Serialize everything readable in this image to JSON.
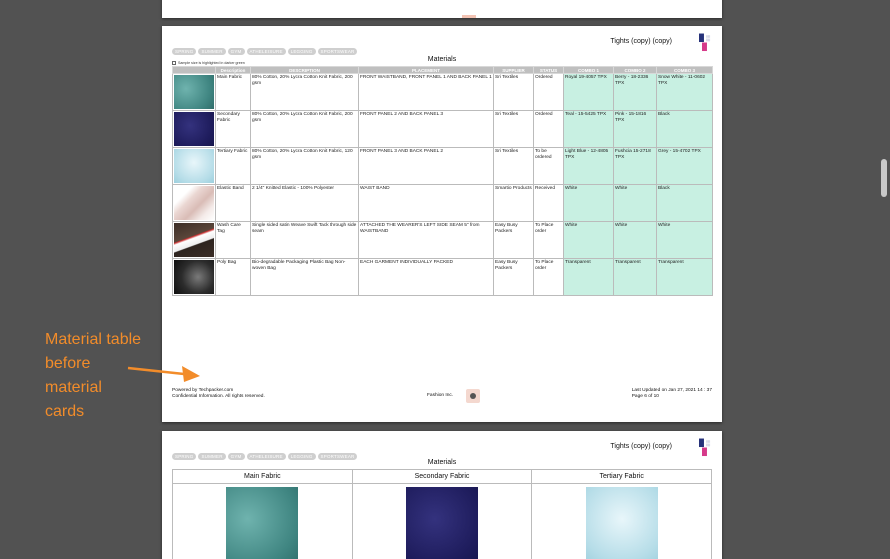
{
  "doc": {
    "title": "Tights (copy) (copy)",
    "tags": [
      "SPRING",
      "SUMMER",
      "GYM",
      "ATHELEISURE",
      "LEGGING",
      "SPORTSWEAR"
    ],
    "section_title": "Materials",
    "note": "Sample size is highlighted in darker green"
  },
  "table": {
    "headers": [
      "",
      "Description",
      "DESCRIPTION",
      "PLACEMENT",
      "SUPPLIER",
      "STATUS",
      "COMBO 1",
      "COMBO 2",
      "COMBO 3"
    ],
    "rows": [
      {
        "swatch": "teal",
        "name": "Main Fabric",
        "description": "80% Cotton, 20% Lycra Cotton Knit Fabric, 200 gsm",
        "placement": "FRONT WAISTBAND, FRONT PANEL 1 AND BACK PANEL 1",
        "supplier": "Sri Textiles",
        "status": "Ordered",
        "combo1": "Royal 19-4057 TPX",
        "combo2": "Berry - 18-2336 TPX",
        "combo3": "Snow White - 11-0602 TPX"
      },
      {
        "swatch": "navy",
        "name": "Secondary Fabric",
        "description": "80% Cotton, 20% Lycra Cotton Knit Fabric, 200 gsm",
        "placement": "FRONT PANEL 2 AND BACK PANEL 3",
        "supplier": "Sri Textiles",
        "status": "Ordered",
        "combo1": "Teal - 15-5425 TPX",
        "combo2": "Pink - 15-1816 TPX",
        "combo3": "Black"
      },
      {
        "swatch": "lightblue",
        "name": "Tertiary Fabric",
        "description": "80% Cotton, 20% Lycra Cotton Knit Fabric, 120 gsm",
        "placement": "FRONT PANEL 3 AND BACK PANEL 2",
        "supplier": "Sri Textiles",
        "status": "To be ordered",
        "combo1": "Light Blue - 12-4805 TPX",
        "combo2": "Fushcia 15-2718 TPX",
        "combo3": "Grey - 15-4702 TPX"
      },
      {
        "swatch": "elastic",
        "name": "Elastic Band",
        "description": "2 1/4\" Knitted Elastic - 100% Polyester",
        "placement": "WAIST BAND",
        "supplier": "Smartio Products",
        "status": "Received",
        "combo1": "White",
        "combo2": "White",
        "combo3": "Black"
      },
      {
        "swatch": "tag",
        "name": "Wash Care Tag",
        "description": "Single sided satin Weave Swift Tack through side seam",
        "placement": "ATTACHED THE WEARER'S LEFT SIDE SEAM 5\" from WAISTBAND",
        "supplier": "Easy Busy Packers",
        "status": "To Place order",
        "combo1": "White",
        "combo2": "White",
        "combo3": "White"
      },
      {
        "swatch": "bag",
        "name": "Poly Bag",
        "description": "Bio-degradable Packaging Plastic Bag Non-woven Bag",
        "placement": "EACH GARMENT INDIVIDUALLY PACKED",
        "supplier": "Easy Busy Packers",
        "status": "To Place order",
        "combo1": "Transparent",
        "combo2": "Transparent",
        "combo3": "Transparent"
      }
    ]
  },
  "footer": {
    "powered": "Powered by Techpacker.com",
    "confidential": "Confidential Information. All rights reserved.",
    "company": "Fashion Inc.",
    "updated": "Last Updated on Jan 27, 2021 14 : 37",
    "page": "Page 6 of 10"
  },
  "next_page": {
    "title": "Tights (copy) (copy)",
    "tags": [
      "SPRING",
      "SUMMER",
      "GYM",
      "ATHELEISURE",
      "LEGGING",
      "SPORTSWEAR"
    ],
    "section_title": "Materials",
    "cards": [
      {
        "label": "Main Fabric",
        "swatch": "teal"
      },
      {
        "label": "Secondary Fabric",
        "swatch": "navy"
      },
      {
        "label": "Tertiary Fabric",
        "swatch": "lightblue"
      }
    ]
  },
  "annotation": {
    "lines": [
      "Material table",
      "before",
      "material",
      "cards"
    ],
    "color": "#f28c2a"
  }
}
